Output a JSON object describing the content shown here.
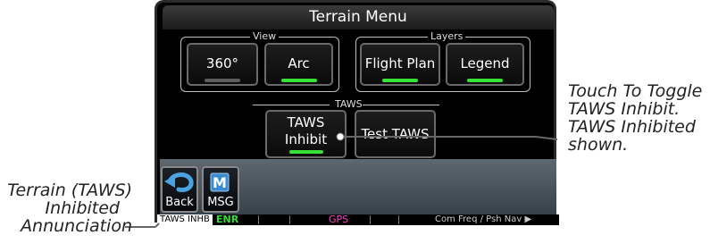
{
  "window": {
    "title": "Terrain Menu"
  },
  "view_group": {
    "label": "View",
    "buttons": [
      {
        "label": "360°",
        "state": "off"
      },
      {
        "label": "Arc",
        "state": "on"
      }
    ]
  },
  "layers_group": {
    "label": "Layers",
    "buttons": [
      {
        "label": "Flight Plan",
        "state": "on"
      },
      {
        "label": "Legend",
        "state": "on"
      }
    ]
  },
  "taws_group": {
    "label": "TAWS",
    "inhibit_line1": "TAWS",
    "inhibit_line2": "Inhibit",
    "inhibit_state": "on",
    "test_label": "Test TAWS"
  },
  "bottom_keys": {
    "back": "Back",
    "msg": "MSG"
  },
  "status_bar": {
    "taws_inhb": "TAWS INHB",
    "enr": "ENR",
    "gps": "GPS",
    "com_freq": "Com Freq / Psh Nav ▶"
  },
  "callouts": {
    "right": [
      "Touch To Toggle",
      "TAWS Inhibit.",
      "TAWS Inhibited",
      "shown."
    ],
    "left": [
      "Terrain (TAWS)",
      "Inhibited",
      "Annunciation"
    ]
  },
  "colors": {
    "annunciator_on": "#36e036",
    "annunciator_off": "#5c5c5c",
    "enr": "#36e036",
    "gps": "#ff3fd1"
  }
}
